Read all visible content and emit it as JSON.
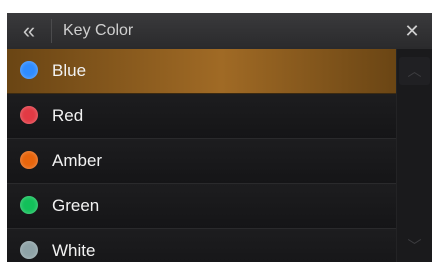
{
  "header": {
    "back_icon": "double-chevron-left-icon",
    "title": "Key Color",
    "close_icon": "close-icon"
  },
  "colors": [
    {
      "label": "Blue",
      "dot_color": "#2f8cff",
      "selected": true
    },
    {
      "label": "Red",
      "dot_color": "#e23a44",
      "selected": false
    },
    {
      "label": "Amber",
      "dot_color": "#e8650c",
      "selected": false
    },
    {
      "label": "Green",
      "dot_color": "#13c05a",
      "selected": false
    },
    {
      "label": "White",
      "dot_color": "#8fa3a7",
      "selected": false
    }
  ],
  "scroll": {
    "up_icon": "chevron-up-icon",
    "down_icon": "chevron-down-icon"
  },
  "accent_color": "#a06a25"
}
